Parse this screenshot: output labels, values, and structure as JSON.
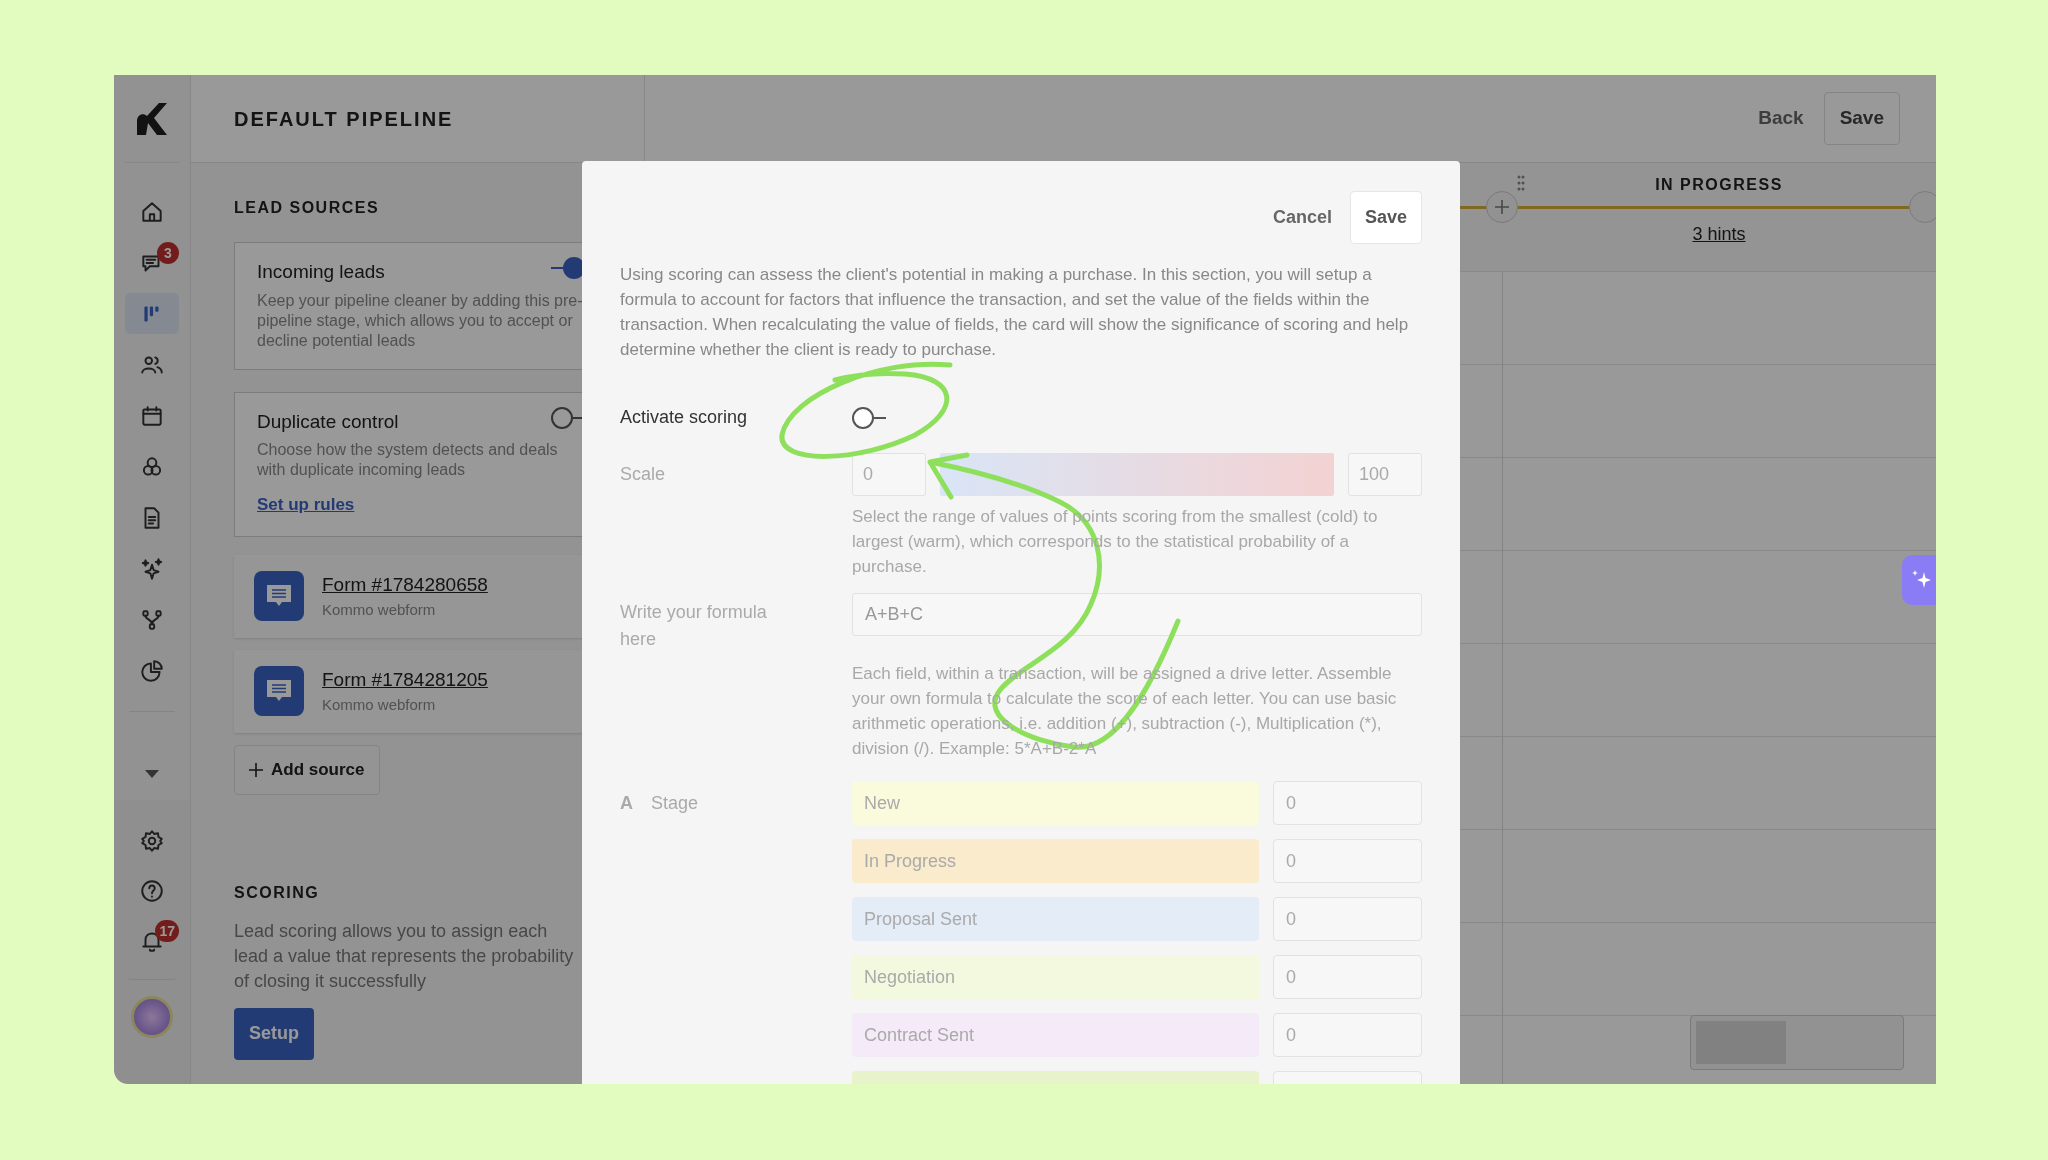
{
  "sidebar": {
    "items": [
      {
        "selected": false
      },
      {
        "selected": false,
        "badge": "3"
      },
      {
        "selected": true
      },
      {
        "selected": false
      },
      {
        "selected": false
      },
      {
        "selected": false
      },
      {
        "selected": false
      },
      {
        "selected": false
      },
      {
        "selected": false
      },
      {
        "selected": false
      }
    ],
    "notifications_badge": "17"
  },
  "header": {
    "title": "DEFAULT PIPELINE",
    "back": "Back",
    "save": "Save"
  },
  "lead_sources": {
    "heading": "LEAD SOURCES",
    "options": [
      {
        "title": "Incoming leads",
        "description": "Keep your pipeline cleaner by adding this pre-pipeline stage, which allows you to accept or decline potential leads",
        "on": true
      },
      {
        "title": "Duplicate control",
        "description": "Choose how the system detects and deals with duplicate incoming leads",
        "on": false,
        "link": "Set up rules"
      }
    ],
    "forms": [
      {
        "name": "Form #1784280658",
        "subtitle": "Kommo webform"
      },
      {
        "name": "Form #1784281205",
        "subtitle": "Kommo webform"
      }
    ],
    "add_button": "Add source"
  },
  "scoring": {
    "heading": "SCORING",
    "description": "Lead scoring allows you to assign each lead a value that represents the probability of closing it successfully",
    "button": "Setup"
  },
  "board": {
    "column": "IN PROGRESS",
    "hints": "3 hints"
  },
  "modal": {
    "cancel": "Cancel",
    "save": "Save",
    "intro": "Using scoring can assess the client's potential in making a purchase. In this section, you will setup a formula to account for factors that influence the transaction, and set the value of the fields within the transaction. When recalculating the value of fields, the card will show the significance of scoring and help determine whether the client is ready to purchase.",
    "activate": {
      "label": "Activate scoring",
      "on": false
    },
    "scale": {
      "label": "Scale",
      "min": "0",
      "max": "100",
      "hint": "Select the range of values of points scoring from the smallest (cold) to largest (warm), which corresponds to the statistical probability of a purchase."
    },
    "formula": {
      "label": "Write your formula here",
      "value": "A+B+C",
      "hint": "Each field, within a transaction, will be assigned a drive letter. Assemble your own formula to calculate the score of each letter. You can use basic arithmetic operations, i.e. addition (+), subtraction (-), Multiplication (*), division (/). Example: 5*A+B-2*A"
    },
    "stage": {
      "letter": "A",
      "label": "Stage",
      "options": [
        {
          "name": "New",
          "color": "#fafadc",
          "placeholder": "0"
        },
        {
          "name": "In Progress",
          "color": "#f9ebcb",
          "placeholder": "0"
        },
        {
          "name": "Proposal Sent",
          "color": "#e4ecf8",
          "placeholder": "0"
        },
        {
          "name": "Negotiation",
          "color": "#f3f9de",
          "placeholder": "0"
        },
        {
          "name": "Contract Sent",
          "color": "#f5eaf8",
          "placeholder": "0"
        },
        {
          "color": "#e8f3cc"
        }
      ]
    }
  }
}
